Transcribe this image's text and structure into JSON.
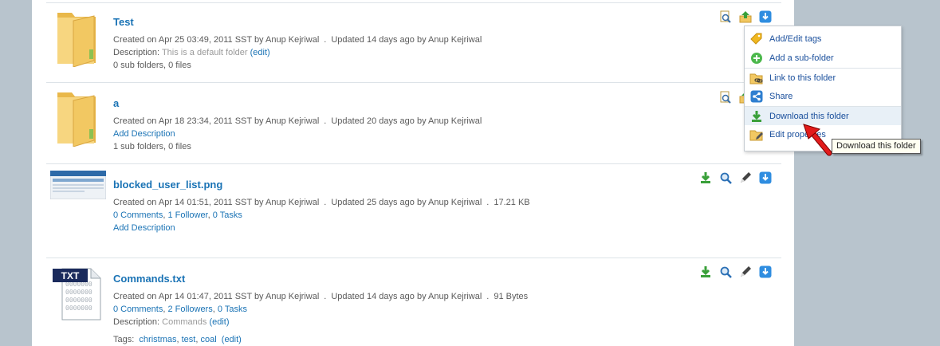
{
  "colors": {
    "page_bg": "#b8c4cd",
    "title": "#1a4f9c",
    "link": "#1a73b5",
    "highlight": "#e8f0f7"
  },
  "items": [
    {
      "title": "Test",
      "created": "Created on Apr 25 03:49, 2011 SST by Anup Kejriwal",
      "updated": "Updated 14 days ago by Anup Kejriwal",
      "desc_label": "Description:",
      "desc_text": "This is a default folder",
      "edit": "(edit)",
      "counts": "0 sub folders, 0 files",
      "icon": "folder-icon"
    },
    {
      "title": "a",
      "created": "Created on Apr 18 23:34, 2011 SST by Anup Kejriwal",
      "updated": "Updated 20 days ago by Anup Kejriwal",
      "add_desc": "Add Description",
      "counts": "1 sub folders, 0 files",
      "icon": "folder-icon"
    },
    {
      "title": "blocked_user_list.png",
      "created": "Created on Apr 14 01:51, 2011 SST by Anup Kejriwal",
      "updated": "Updated 25 days ago by Anup Kejriwal",
      "size": "17.21 KB",
      "comments": "0 Comments",
      "followers": "1 Follower",
      "tasks": "0 Tasks",
      "sep": ",",
      "add_desc": "Add Description",
      "icon": "image-thumbnail"
    },
    {
      "title": "Commands.txt",
      "created": "Created on Apr 14 01:47, 2011 SST by Anup Kejriwal",
      "updated": "Updated 14 days ago by Anup Kejriwal",
      "size": "91 Bytes",
      "comments": "0 Comments",
      "followers": "2 Followers",
      "tasks": "0 Tasks",
      "sep": ",",
      "desc_label": "Description:",
      "desc_text": "Commands",
      "edit": "(edit)",
      "tags_label": "Tags:",
      "tags": [
        "christmas",
        "test",
        "coal"
      ],
      "tags_edit": "(edit)",
      "file_badge": "TXT",
      "icon": "txt-file-icon"
    }
  ],
  "dot": ".",
  "menu": {
    "items": [
      {
        "label": "Add/Edit tags",
        "icon": "tag-icon"
      },
      {
        "label": "Add a sub-folder",
        "icon": "add-circle-icon"
      },
      {
        "label": "Link to this folder",
        "icon": "link-folder-icon"
      },
      {
        "label": "Share",
        "icon": "share-icon"
      },
      {
        "label": "Download this folder",
        "icon": "download-icon"
      },
      {
        "label": "Edit properties",
        "icon": "edit-folder-icon"
      }
    ]
  },
  "tooltip": "Download this folder"
}
